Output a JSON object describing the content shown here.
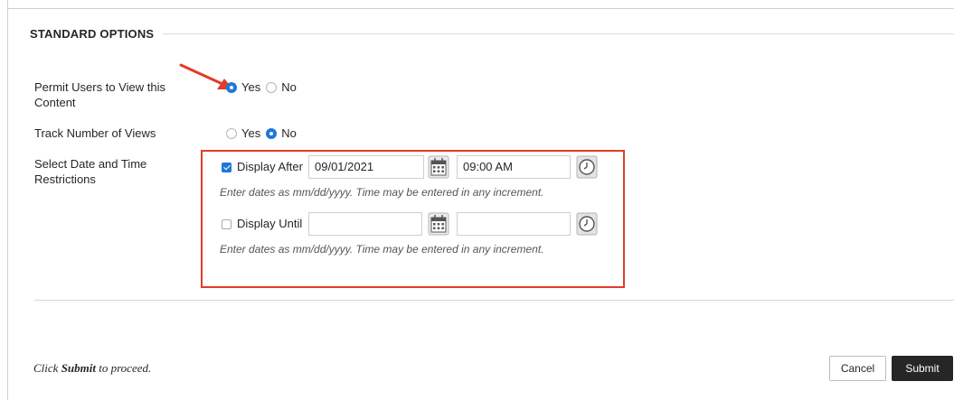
{
  "section": {
    "title": "STANDARD OPTIONS"
  },
  "permit_view": {
    "label_line1": "Permit Users to View this",
    "label_line2": "Content",
    "yes": "Yes",
    "no": "No",
    "selected": "Yes"
  },
  "track_views": {
    "label": "Track Number of Views",
    "yes": "Yes",
    "no": "No",
    "selected": "No"
  },
  "date_restrictions": {
    "label_line1": "Select Date and Time",
    "label_line2": "Restrictions",
    "display_after": {
      "label": "Display After",
      "checked": true,
      "date": "09/01/2021",
      "time": "09:00 AM"
    },
    "display_until": {
      "label": "Display Until",
      "checked": false,
      "date": "",
      "time": ""
    },
    "hint": "Enter dates as mm/dd/yyyy. Time may be entered in any increment."
  },
  "footer": {
    "prefix": "Click ",
    "emphasis": "Submit",
    "suffix": " to proceed.",
    "cancel_label": "Cancel",
    "submit_label": "Submit"
  },
  "colors": {
    "accent": "#1e78d6",
    "highlight": "#e23c2a",
    "submit_bg": "#262626"
  },
  "icons": [
    "calendar-icon",
    "clock-icon",
    "annotation-arrow"
  ]
}
